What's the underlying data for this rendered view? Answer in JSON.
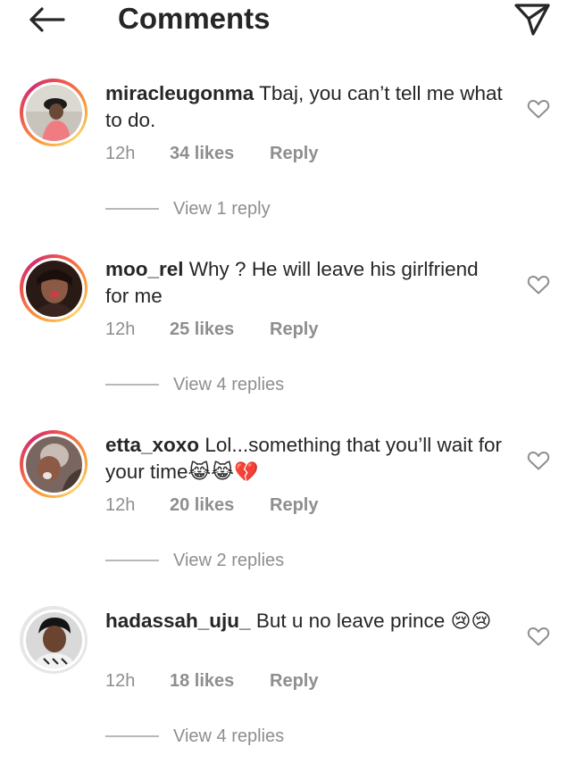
{
  "header": {
    "title": "Comments",
    "back_icon": "arrow-left-icon",
    "share_icon": "paper-plane-icon"
  },
  "comments": [
    {
      "username": "miracleugonma",
      "text": "Tbaj, you can’t tell me what to do.",
      "time": "12h",
      "likes": "34 likes",
      "reply": "Reply",
      "view_replies": "View 1 reply"
    },
    {
      "username": "moo_rel",
      "text": "Why ? He will leave his girlfriend for me",
      "time": "12h",
      "likes": "25 likes",
      "reply": "Reply",
      "view_replies": "View 4 replies"
    },
    {
      "username": "etta_xoxo",
      "text": "Lol...something that you’ll wait for your time",
      "emoji": "😹😹💔",
      "time": "12h",
      "likes": "20 likes",
      "reply": "Reply",
      "view_replies": "View 2 replies"
    },
    {
      "username": "hadassah_uju_",
      "text": "But u no leave prince",
      "emoji": "😢😢",
      "time": "12h",
      "likes": "18 likes",
      "reply": "Reply",
      "view_replies": "View 4 replies"
    }
  ],
  "colors": {
    "text": "#262626",
    "secondary": "#8e8e8e",
    "story_ring": "#f0584b"
  }
}
